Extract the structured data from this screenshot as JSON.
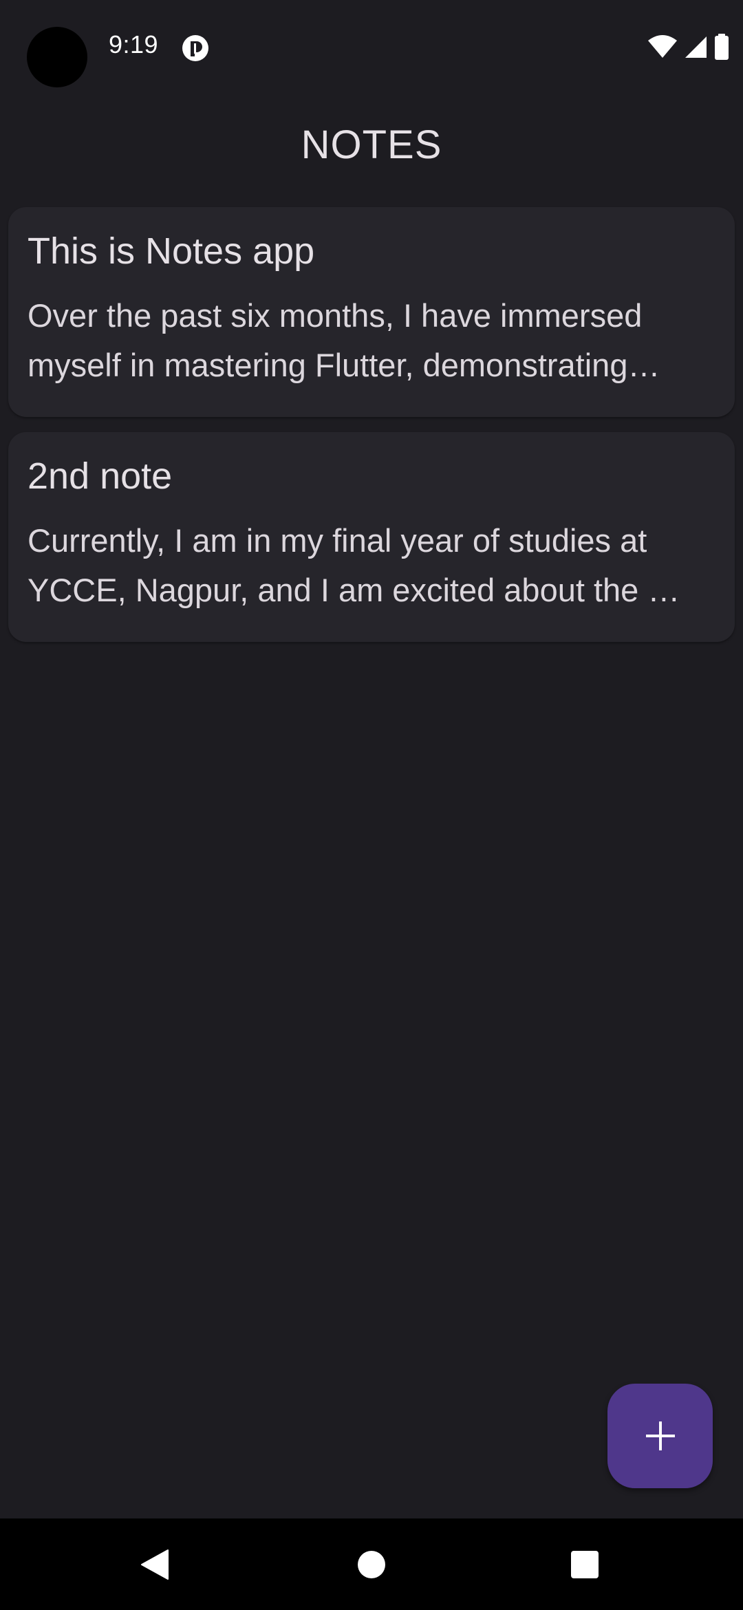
{
  "status_bar": {
    "time": "9:19",
    "icons": [
      "app-notification-icon",
      "wifi-icon",
      "cellular-signal-icon",
      "battery-icon"
    ]
  },
  "app_bar": {
    "title": "NOTES"
  },
  "notes": [
    {
      "title": "This is Notes app",
      "body": "Over the past six months, I have immersed myself in mastering Flutter, demonstrating…"
    },
    {
      "title": "2nd note",
      "body": "Currently, I am in my final year of studies at YCCE, Nagpur, and I am excited about the …"
    }
  ],
  "fab": {
    "icon": "add-icon",
    "color": "#4f378b"
  },
  "nav_bar": {
    "icons": [
      "back-icon",
      "home-icon",
      "recents-icon"
    ]
  },
  "colors": {
    "background": "#1d1c21",
    "card": "#26252b",
    "accent": "#4f378b"
  }
}
